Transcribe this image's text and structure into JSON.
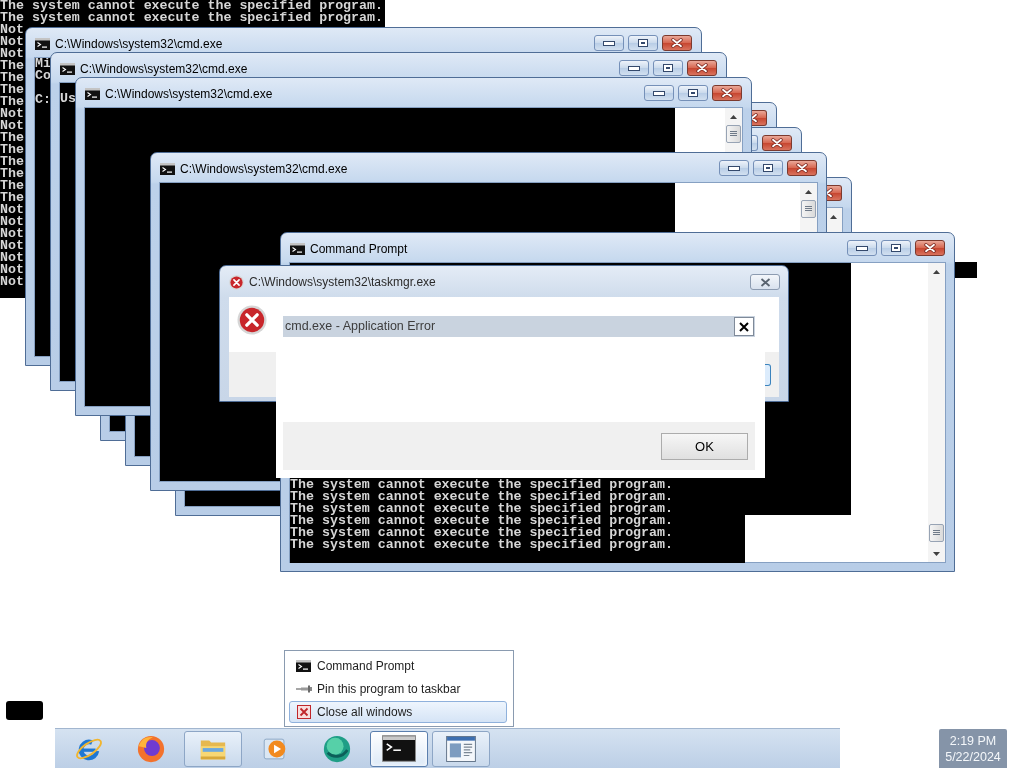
{
  "background_console": {
    "lines": [
      "The system cannot execute the specified program.",
      "The system cannot execute the specified program.",
      "Not",
      "Not",
      "Not",
      "The",
      "The",
      "The",
      "The",
      "Not",
      "Not",
      "The",
      "The",
      "The",
      "The",
      "The",
      "The",
      "Not",
      "Not",
      "Not",
      "Not",
      "Not",
      "Not",
      "Not"
    ]
  },
  "windows": [
    {
      "kind": "console",
      "title": "C:\\Windows\\system32\\cmd.exe",
      "blocks": [
        [
          "Mi",
          "Co"
        ],
        [
          "C:"
        ]
      ]
    },
    {
      "kind": "console",
      "title": "C:\\Windows\\system32\\cmd.exe",
      "blocks": [
        [
          "Us"
        ]
      ]
    },
    {
      "kind": "console",
      "title": "C:\\Windows\\system32\\cmd.exe"
    },
    {
      "kind": "console"
    },
    {
      "kind": "console"
    },
    {
      "kind": "console",
      "title": "C:\\Windows\\system32\\cmd.exe"
    },
    {
      "kind": "console"
    },
    {
      "kind": "console",
      "title": "Command Prompt",
      "lines": [
        "The system cannot execute the specified program.",
        "The system cannot execute the specified program.",
        "The system cannot execute the specified program.",
        "The system cannot execute the specified program.",
        "The system cannot execute the specified program.",
        "The system cannot execute the specified program."
      ]
    },
    {
      "kind": "dialog",
      "title": "C:\\Windows\\system32\\taskmgr.exe"
    },
    {
      "kind": "message",
      "title": "cmd.exe - Application Error",
      "button": "OK"
    }
  ],
  "jump_list": {
    "items": [
      {
        "label": "Command Prompt",
        "selected": false
      },
      {
        "label": "Pin this program to taskbar",
        "selected": false
      },
      {
        "label": "Close all windows",
        "selected": true
      }
    ]
  },
  "taskbar": {
    "apps": [
      {
        "running": false,
        "selected": false
      },
      {
        "running": false,
        "selected": false
      },
      {
        "running": true,
        "selected": false
      },
      {
        "running": false,
        "selected": false
      },
      {
        "running": false,
        "selected": false
      },
      {
        "running": true,
        "selected": true
      },
      {
        "running": true,
        "selected": false
      }
    ]
  },
  "clock": {
    "time": "2:19 PM",
    "date": "5/22/2024"
  }
}
